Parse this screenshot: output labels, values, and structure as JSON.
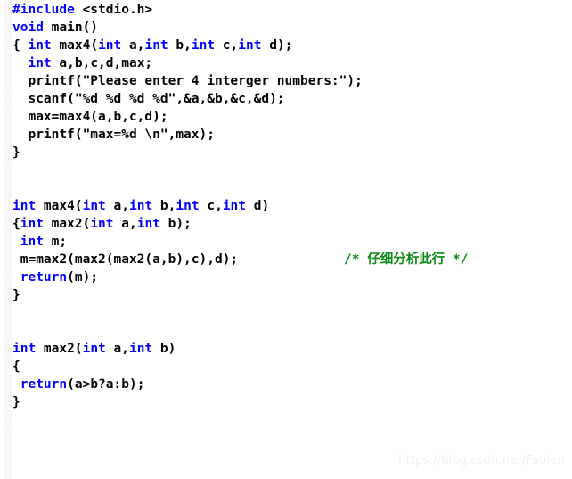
{
  "editor": {
    "language": "c",
    "colors": {
      "background": "#ffffff",
      "text": "#000000",
      "keyword": "#0000ff",
      "comment": "#0b8a14",
      "gutter": "#f4f4f4",
      "watermark": "#f0f0f0"
    }
  },
  "code": {
    "lines": [
      {
        "indent": "",
        "parts": [
          {
            "t": "kw",
            "v": "#include"
          },
          {
            "t": "tx",
            "v": " <stdio.h>"
          }
        ]
      },
      {
        "indent": "",
        "parts": [
          {
            "t": "kw",
            "v": "void"
          },
          {
            "t": "tx",
            "v": " main()"
          }
        ]
      },
      {
        "indent": "",
        "parts": [
          {
            "t": "tx",
            "v": "{ "
          },
          {
            "t": "kw",
            "v": "int"
          },
          {
            "t": "tx",
            "v": " max4("
          },
          {
            "t": "kw",
            "v": "int"
          },
          {
            "t": "tx",
            "v": " a,"
          },
          {
            "t": "kw",
            "v": "int"
          },
          {
            "t": "tx",
            "v": " b,"
          },
          {
            "t": "kw",
            "v": "int"
          },
          {
            "t": "tx",
            "v": " c,"
          },
          {
            "t": "kw",
            "v": "int"
          },
          {
            "t": "tx",
            "v": " d);"
          }
        ]
      },
      {
        "indent": "",
        "parts": [
          {
            "t": "tx",
            "v": "  "
          },
          {
            "t": "kw",
            "v": "int"
          },
          {
            "t": "tx",
            "v": " a,b,c,d,max;"
          }
        ]
      },
      {
        "indent": "",
        "parts": [
          {
            "t": "tx",
            "v": "  printf(\"Please enter 4 interger numbers:\");"
          }
        ]
      },
      {
        "indent": "",
        "parts": [
          {
            "t": "tx",
            "v": "  scanf(\"%d %d %d %d\",&a,&b,&c,&d);"
          }
        ]
      },
      {
        "indent": "",
        "parts": [
          {
            "t": "tx",
            "v": "  max=max4(a,b,c,d);"
          }
        ]
      },
      {
        "indent": "",
        "parts": [
          {
            "t": "tx",
            "v": "  printf(\"max=%d \\n\",max);"
          }
        ]
      },
      {
        "indent": "",
        "parts": [
          {
            "t": "tx",
            "v": "}"
          }
        ]
      },
      {
        "indent": "",
        "parts": []
      },
      {
        "indent": "",
        "parts": []
      },
      {
        "indent": "",
        "parts": [
          {
            "t": "kw",
            "v": "int"
          },
          {
            "t": "tx",
            "v": " max4("
          },
          {
            "t": "kw",
            "v": "int"
          },
          {
            "t": "tx",
            "v": " a,"
          },
          {
            "t": "kw",
            "v": "int"
          },
          {
            "t": "tx",
            "v": " b,"
          },
          {
            "t": "kw",
            "v": "int"
          },
          {
            "t": "tx",
            "v": " c,"
          },
          {
            "t": "kw",
            "v": "int"
          },
          {
            "t": "tx",
            "v": " d)"
          }
        ]
      },
      {
        "indent": "",
        "parts": [
          {
            "t": "tx",
            "v": "{"
          },
          {
            "t": "kw",
            "v": "int"
          },
          {
            "t": "tx",
            "v": " max2("
          },
          {
            "t": "kw",
            "v": "int"
          },
          {
            "t": "tx",
            "v": " a,"
          },
          {
            "t": "kw",
            "v": "int"
          },
          {
            "t": "tx",
            "v": " b);"
          }
        ]
      },
      {
        "indent": "",
        "parts": [
          {
            "t": "tx",
            "v": " "
          },
          {
            "t": "kw",
            "v": "int"
          },
          {
            "t": "tx",
            "v": " m;"
          }
        ]
      },
      {
        "indent": "",
        "parts": [
          {
            "t": "tx",
            "v": " m=max2(max2(max2(a,b),c),d);"
          }
        ],
        "comment": "/* 仔细分析此行 */"
      },
      {
        "indent": "",
        "parts": [
          {
            "t": "tx",
            "v": " "
          },
          {
            "t": "kw",
            "v": "return"
          },
          {
            "t": "tx",
            "v": "(m);"
          }
        ]
      },
      {
        "indent": "",
        "parts": [
          {
            "t": "tx",
            "v": "}"
          }
        ]
      },
      {
        "indent": "",
        "parts": []
      },
      {
        "indent": "",
        "parts": []
      },
      {
        "indent": "",
        "parts": [
          {
            "t": "kw",
            "v": "int"
          },
          {
            "t": "tx",
            "v": " max2("
          },
          {
            "t": "kw",
            "v": "int"
          },
          {
            "t": "tx",
            "v": " a,"
          },
          {
            "t": "kw",
            "v": "int"
          },
          {
            "t": "tx",
            "v": " b)"
          }
        ]
      },
      {
        "indent": "",
        "parts": [
          {
            "t": "tx",
            "v": "{"
          }
        ]
      },
      {
        "indent": "",
        "parts": [
          {
            "t": "tx",
            "v": " "
          },
          {
            "t": "kw",
            "v": "return"
          },
          {
            "t": "tx",
            "v": "(a>b?a:b);"
          }
        ]
      },
      {
        "indent": "",
        "parts": [
          {
            "t": "tx",
            "v": "}"
          }
        ]
      }
    ]
  },
  "watermark": {
    "text": "https://blog.csdn.net/Faulen"
  }
}
